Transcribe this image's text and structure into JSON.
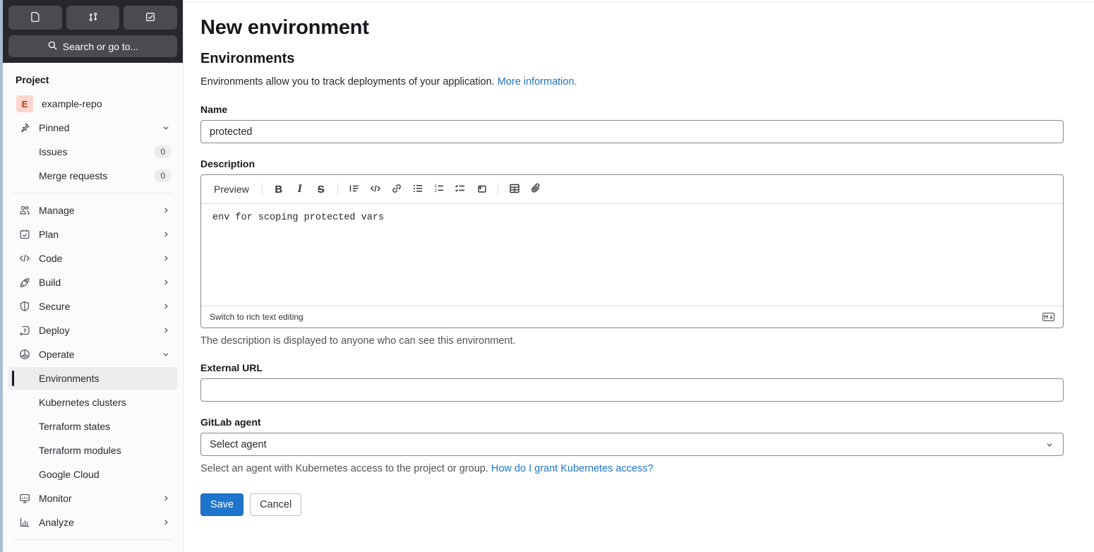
{
  "colors": {
    "header_dark": "#28272d",
    "header_button": "#4b4a51",
    "sidebar_bg": "#fbfafd",
    "active_item_bg": "#ececef",
    "avatar_bg": "#fcd6cc",
    "avatar_text": "#aa3b22",
    "link_blue": "#1f75cb",
    "save_button": "#1f75cb",
    "input_border": "#89888d"
  },
  "icons": {
    "header": [
      "issues-icon",
      "merge-request-icon",
      "todos-icon"
    ],
    "search": "search-icon (magnifier)",
    "markdown": "markdown-icon (M with down arrow)",
    "toolbar": [
      "quote-icon",
      "code-icon",
      "link-icon",
      "bullet-list-icon",
      "numbered-list-icon",
      "task-list-icon",
      "collapsible-section-icon",
      "table-icon",
      "paperclip-icon"
    ]
  },
  "sidebar": {
    "search_label": "Search or go to...",
    "section_label": "Project",
    "project": {
      "avatar_letter": "E",
      "name": "example-repo"
    },
    "pinned": {
      "label": "Pinned",
      "items": [
        {
          "label": "Issues",
          "count": "0"
        },
        {
          "label": "Merge requests",
          "count": "0"
        }
      ]
    },
    "nav": [
      {
        "label": "Manage"
      },
      {
        "label": "Plan"
      },
      {
        "label": "Code"
      },
      {
        "label": "Build"
      },
      {
        "label": "Secure"
      },
      {
        "label": "Deploy"
      },
      {
        "label": "Operate"
      }
    ],
    "operate_children": [
      {
        "label": "Environments",
        "active": true
      },
      {
        "label": "Kubernetes clusters"
      },
      {
        "label": "Terraform states"
      },
      {
        "label": "Terraform modules"
      },
      {
        "label": "Google Cloud"
      }
    ],
    "nav_bottom": [
      {
        "label": "Monitor"
      },
      {
        "label": "Analyze"
      }
    ]
  },
  "main": {
    "title": "New environment",
    "section_title": "Environments",
    "intro_text": "Environments allow you to track deployments of your application.",
    "intro_link": "More information.",
    "name_field": {
      "label": "Name",
      "value": "protected"
    },
    "description_field": {
      "label": "Description",
      "toolbar": {
        "preview_label": "Preview",
        "bold_glyph": "B",
        "italic_glyph": "I",
        "strike_glyph": "S"
      },
      "value": "env for scoping protected vars",
      "switch_label": "Switch to rich text editing",
      "help_text": "The description is displayed to anyone who can see this environment."
    },
    "external_url_field": {
      "label": "External URL",
      "value": ""
    },
    "agent_field": {
      "label": "GitLab agent",
      "selected": "Select agent",
      "help_text": "Select an agent with Kubernetes access to the project or group.",
      "help_link": "How do I grant Kubernetes access?"
    },
    "actions": {
      "save": "Save",
      "cancel": "Cancel"
    }
  }
}
